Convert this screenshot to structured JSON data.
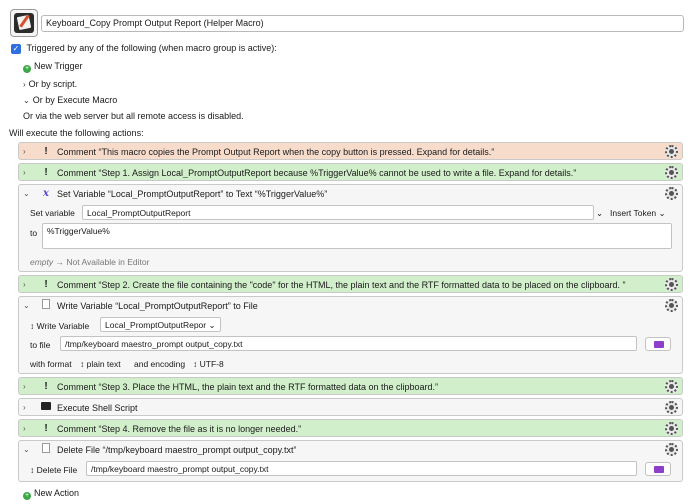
{
  "macro": {
    "title": "Keyboard_Copy Prompt Output Report (Helper Macro)",
    "icon": "macro-pen-icon"
  },
  "triggers": {
    "checkbox_label": "Triggered by any of the following (when macro group is active):",
    "new_trigger": "New Trigger",
    "or_by_script": "Or by script.",
    "or_by_execute_macro": "Or by Execute Macro",
    "web_server_note": "Or via the web server but all remote access is disabled."
  },
  "will_execute": "Will execute the following actions:",
  "actions": {
    "a1": {
      "title": "Comment “This macro copies the Prompt Output Report when the copy button is pressed.  Expand for details.”"
    },
    "a2": {
      "title": "Comment “Step 1. Assign Local_PromptOutputReport because %TriggerValue% cannot be used to write a file. Expand for details.”"
    },
    "a3": {
      "title": "Set Variable “Local_PromptOutputReport” to Text “%TriggerValue%”",
      "set_variable_label": "Set variable",
      "variable_value": "Local_PromptOutputReport",
      "insert_token": "Insert Token ⌄",
      "to_label": "to",
      "to_value": "%TriggerValue%",
      "empty_label": "empty",
      "empty_arrow": "→",
      "empty_note": "Not Available in Editor"
    },
    "a4": {
      "title": "Comment “Step 2. Create the file containing the \"code\" for the HTML, the plain text and the RTF formatted data to be placed on the clipboard. ”"
    },
    "a5": {
      "title": "Write Variable “Local_PromptOutputReport” to File",
      "write_label": "↕ Write Variable",
      "variable_value": "Local_PromptOutputRepor ⌄",
      "to_file_label": "to file",
      "file_path": "/tmp/keyboard maestro_prompt output_copy.txt",
      "with_format_label": "with format",
      "format_value": "↕ plain text",
      "encoding_label": "and encoding",
      "encoding_value": "↕ UTF-8"
    },
    "a6": {
      "title": "Comment “Step 3. Place the HTML, the plain text and the RTF formatted data on the clipboard.”"
    },
    "a7": {
      "title": "Execute Shell Script"
    },
    "a8": {
      "title": "Comment “Step 4. Remove the file as it is no longer needed.”"
    },
    "a9": {
      "title": "Delete File “/tmp/keyboard maestro_prompt output_copy.txt”",
      "delete_label": "↕ Delete File",
      "file_path": "/tmp/keyboard maestro_prompt output_copy.txt"
    }
  },
  "new_action": "New Action",
  "colors": {
    "orange_comment": "#f7dccc",
    "green_comment": "#d2efcb",
    "checkbox": "#2f6fe0",
    "folder": "#8e3fc9"
  }
}
